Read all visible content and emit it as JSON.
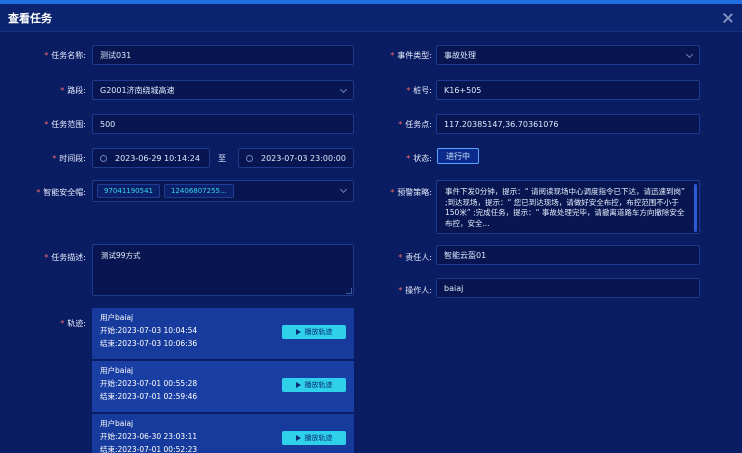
{
  "window": {
    "title": "查看任务"
  },
  "labels": {
    "task_name": "任务名称:",
    "event_type": "事件类型:",
    "road": "路段:",
    "stake": "桩号:",
    "task_range": "任务范围:",
    "coordinates": "任务点:",
    "time_period": "时间段:",
    "status": "状态:",
    "smart_helmet": "智能安全帽:",
    "strategy": "预警策略:",
    "description": "任务描述:",
    "responsible": "责任人:",
    "operator": "操作人:",
    "track": "轨迹:"
  },
  "fields": {
    "task_name": "测试031",
    "event_type": "事故处理",
    "road": "G2001济南绕城高速",
    "stake": "K16+505",
    "task_range": "500",
    "coordinates": "117.20385147,36.70361076",
    "time_start": "2023-06-29 10:14:24",
    "time_to": "至",
    "time_end": "2023-07-03 23:00:00",
    "status": "进行中",
    "helmet_tags": [
      "97041190541",
      "12406807255..."
    ],
    "strategy_text": "事件下发0分钟，提示：“ 请阅读现场中心调度指令已下达，请迅速到岗” ;到达现场，提示：“ 您已到达现场，请做好安全布控，布控范围不小于150米” ;完成任务，提示：“ 事故处理完毕，请撤离道路车方向撤除安全布控，安全...",
    "description": "测试99方式",
    "responsible": "智能云盔01",
    "operator": "baiaj"
  },
  "tracks": [
    {
      "user": "用户baiaj",
      "start": "开始:2023-07-03 10:04:54",
      "end": "结束:2023-07-03 10:06:36",
      "button": "播放轨迹"
    },
    {
      "user": "用户baiaj",
      "start": "开始:2023-07-01 00:55:28",
      "end": "结束:2023-07-01 02:59:46",
      "button": "播放轨迹"
    },
    {
      "user": "用户baiaj",
      "start": "开始:2023-06-30 23:03:11",
      "end": "结束:2023-07-01 00:52:23",
      "button": "播放轨迹"
    }
  ]
}
